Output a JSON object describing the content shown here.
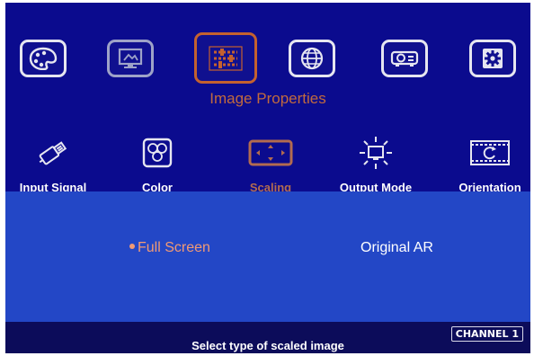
{
  "category": {
    "title": "Image Properties"
  },
  "top_menu": [
    {
      "icon": "palette-icon"
    },
    {
      "icon": "monitor-icon"
    },
    {
      "icon": "image-properties-icon",
      "selected": true
    },
    {
      "icon": "globe-icon"
    },
    {
      "icon": "projector-icon"
    },
    {
      "icon": "gear-icon"
    }
  ],
  "sub_menu": [
    {
      "label": "Input Signal",
      "icon": "usb-connector-icon"
    },
    {
      "label": "Color",
      "icon": "color-circles-icon"
    },
    {
      "label": "Scaling",
      "icon": "scaling-arrows-icon",
      "selected": true
    },
    {
      "label": "Output Mode",
      "icon": "output-monitor-icon"
    },
    {
      "label": "Orientation",
      "icon": "rotate-icon"
    }
  ],
  "options": [
    {
      "label": "Full Screen",
      "selected": true
    },
    {
      "label": "Original AR",
      "selected": false
    }
  ],
  "status": {
    "channel": "CHANNEL 1",
    "hint": "Select type of scaled image"
  },
  "colors": {
    "background": "#0b0b8e",
    "panel": "#2347c6",
    "selected_border": "#c4612f",
    "selected_text": "#f19a75",
    "category_title": "#c16a3e"
  }
}
